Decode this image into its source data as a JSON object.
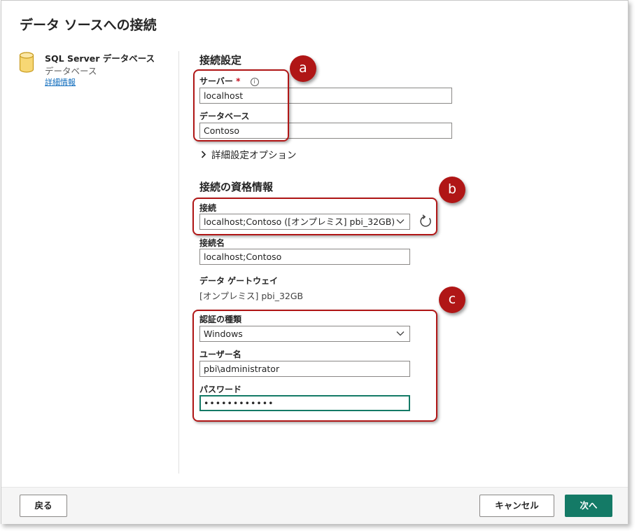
{
  "dialog": {
    "title": "データ ソースへの接続"
  },
  "source": {
    "name": "SQL Server データベース",
    "type": "データベース",
    "link": "詳細情報",
    "icon": "database-icon"
  },
  "connection_settings": {
    "heading": "接続設定",
    "server_label": "サーバー",
    "required_mark": "*",
    "info_icon": "ⓘ",
    "server_value": "localhost",
    "database_label": "データベース",
    "database_value": "Contoso",
    "advanced_label": "詳細設定オプション"
  },
  "credentials": {
    "heading": "接続の資格情報",
    "connection_label": "接続",
    "connection_value": "localhost;Contoso ([オンプレミス] pbi_32GB)",
    "connection_name_label": "接続名",
    "connection_name_value": "localhost;Contoso",
    "gateway_label": "データ ゲートウェイ",
    "gateway_value": "[オンプレミス] pbi_32GB",
    "auth_label": "認証の種類",
    "auth_value": "Windows",
    "username_label": "ユーザー名",
    "username_value": "pbi\\administrator",
    "password_label": "パスワード",
    "password_value": "••••••••••••"
  },
  "annotations": {
    "a": "a",
    "b": "b",
    "c": "c",
    "color": "#b01616"
  },
  "footer": {
    "back": "戻る",
    "cancel": "キャンセル",
    "next": "次へ"
  },
  "colors": {
    "accent": "#147a66",
    "link": "#0f6cbd"
  }
}
